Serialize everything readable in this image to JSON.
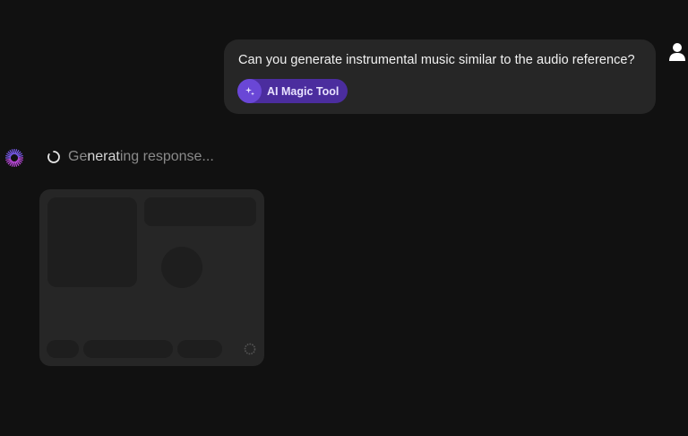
{
  "user_message": {
    "text": "Can you generate instrumental music similar to the audio reference?",
    "tool_chip": {
      "label": "AI Magic Tool",
      "icon": "sparkle-icon"
    },
    "avatar_icon": "user-icon"
  },
  "assistant": {
    "avatar_icon": "ai-logo-icon",
    "status": {
      "prefix": "Ge",
      "highlight": "nerat",
      "suffix": "ing response...",
      "icon": "loading-spinner-icon"
    }
  },
  "colors": {
    "background": "#111111",
    "bubble": "#262626",
    "chip": "#4b2d9e",
    "chip_icon": "#6a47d6",
    "accent_purple": "#9b5cf6"
  }
}
